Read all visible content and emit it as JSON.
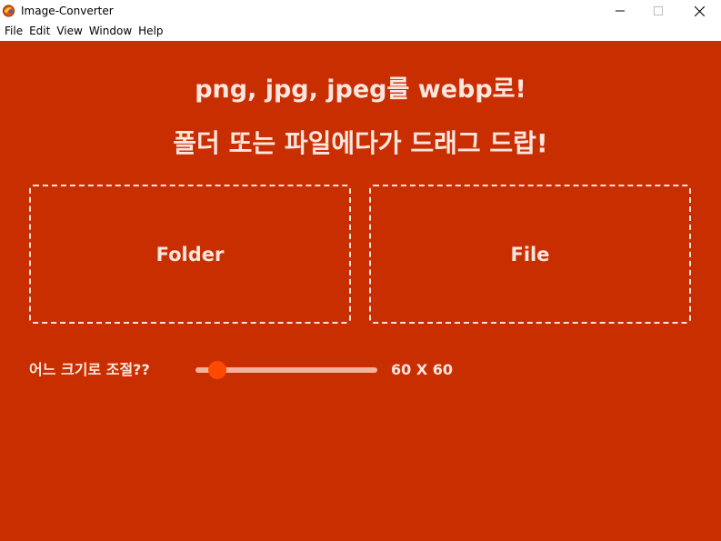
{
  "window": {
    "title": "Image-Converter",
    "icon": "app-logo-icon",
    "controls": {
      "minimize": "minimize-icon",
      "maximize": "maximize-icon",
      "close": "close-icon"
    }
  },
  "menu": {
    "items": [
      {
        "label": "File"
      },
      {
        "label": "Edit"
      },
      {
        "label": "View"
      },
      {
        "label": "Window"
      },
      {
        "label": "Help"
      }
    ]
  },
  "main": {
    "heading_1": "png, jpg, jpeg를 webp로!",
    "heading_2": "폴더 또는 파일에다가 드래그 드랍!",
    "drop_zones": {
      "folder_label": "Folder",
      "file_label": "File"
    },
    "size": {
      "label": "어느 크기로 조절??",
      "value_text": "60 X 60",
      "slider_fraction": 0.08
    }
  },
  "colors": {
    "background": "#c82e00",
    "text": "#fde6df",
    "dashed_border": "#fbe3dc",
    "slider_track": "#f3b29c",
    "slider_thumb": "#ff4a00"
  }
}
